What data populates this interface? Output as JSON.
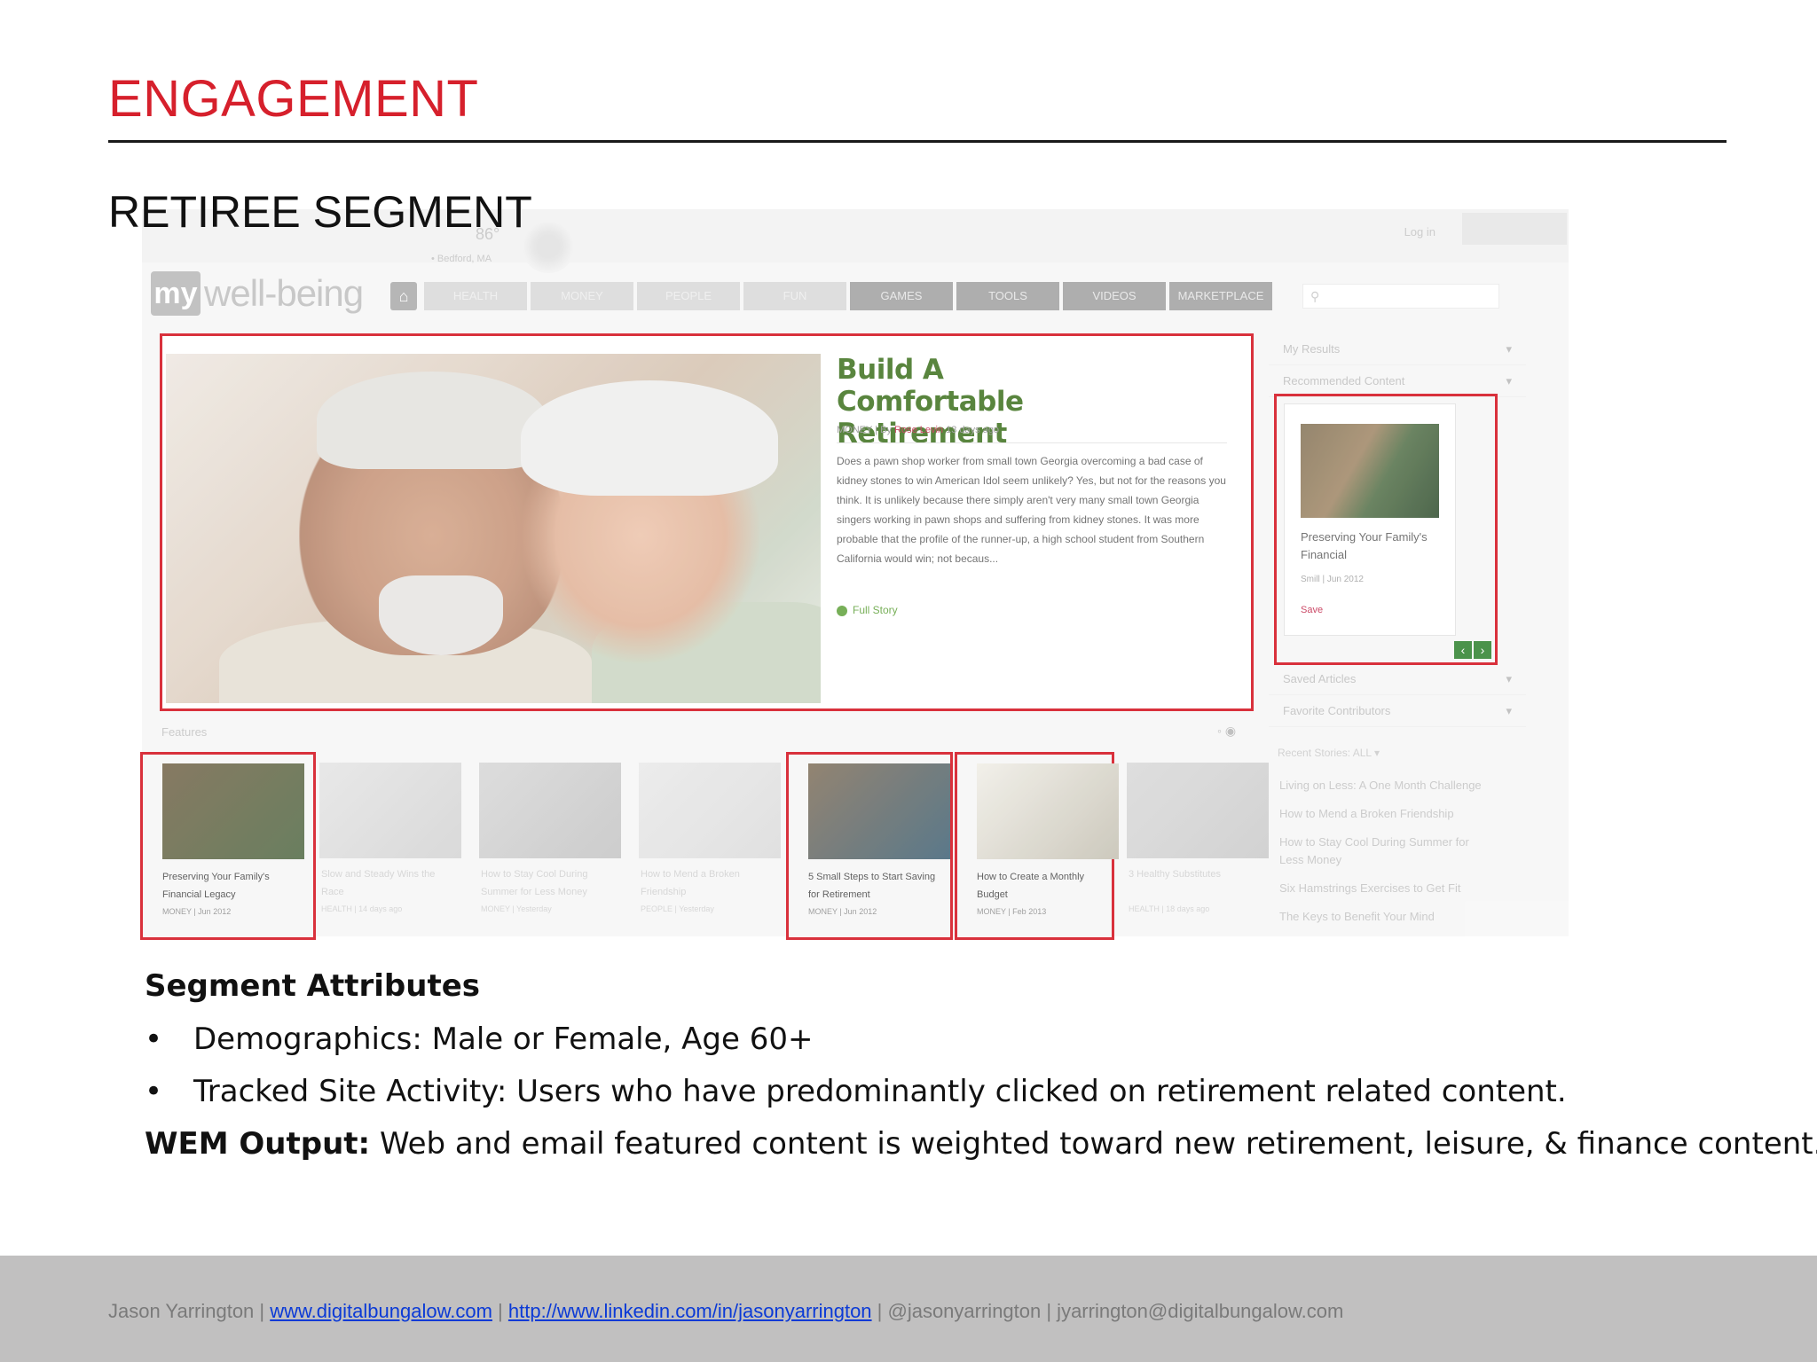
{
  "slide": {
    "title": "ENGAGEMENT",
    "subtitle": "RETIREE SEGMENT"
  },
  "site": {
    "login": "Log in",
    "weather_temp": "86°",
    "weather_location": "• Bedford, MA",
    "logo_my": "my",
    "logo_name": "well-being",
    "nav": [
      "HEALTH",
      "MONEY",
      "PEOPLE",
      "FUN",
      "GAMES",
      "TOOLS",
      "VIDEOS",
      "MARKETPLACE"
    ],
    "hero": {
      "title": "Build A Comfortable Retirement",
      "meta_section": "MONEY | By ",
      "meta_author": "Rose Levin",
      "meta_time": " 13 days ago",
      "body": "Does a pawn shop worker from small town Georgia overcoming a bad case of kidney stones to win American Idol seem unlikely? Yes, but not for the reasons you think. It is unlikely because there simply aren't very many small town Georgia singers working in pawn shops and suffering from kidney stones. It was more probable that the profile of the runner-up, a high school student from Southern California would win; not becaus...",
      "full_story": "Full Story"
    },
    "sidebar": {
      "my_results": "My Results",
      "recommended": "Recommended Content",
      "rec_title": "Preserving Your Family's Financial",
      "rec_meta": "Smill | Jun 2012",
      "rec_save": "Save",
      "saved_articles": "Saved Articles",
      "favorite_contributors": "Favorite Contributors",
      "recent_stories": "Recent Stories: ALL ▾",
      "recent": [
        "Living on Less: A One Month Challenge",
        "How to Mend a Broken Friendship",
        "How to Stay Cool During Summer for Less Money",
        "Six Hamstrings Exercises to Get Fit",
        "The Keys to Benefit Your Mind"
      ]
    },
    "features_label": "Features",
    "tiles": [
      {
        "title": "Preserving Your Family's Financial Legacy",
        "meta": "MONEY | Jun 2012",
        "color1": "#7d6e55",
        "color2": "#5d7552"
      },
      {
        "title": "Slow and Steady Wins the Race",
        "meta": "HEALTH | 14 days ago",
        "color1": "#e6e6e6",
        "color2": "#d7d7d7"
      },
      {
        "title": "How to Stay Cool During Summer for Less Money",
        "meta": "MONEY | Yesterday",
        "color1": "#dadada",
        "color2": "#c9c9c9"
      },
      {
        "title": "How to Mend a Broken Friendship",
        "meta": "PEOPLE | Yesterday",
        "color1": "#ebebeb",
        "color2": "#dedede"
      },
      {
        "title": "5 Small Steps to Start Saving for Retirement",
        "meta": "MONEY | Jun 2012",
        "color1": "#8a7a66",
        "color2": "#4d6d80"
      },
      {
        "title": "How to Create a Monthly Budget",
        "meta": "MONEY | Feb 2013",
        "color1": "#f1efe8",
        "color2": "#c9c5b8"
      },
      {
        "title": "3 Healthy Substitutes",
        "meta": "HEALTH | 18 days ago",
        "color1": "#dcdcdc",
        "color2": "#cfcfcf"
      }
    ]
  },
  "caption": {
    "attr_heading": "Segment Attributes",
    "bullets": [
      "Demographics: Male or Female, Age 60+",
      "Tracked Site Activity: Users who have predominantly clicked on retirement related content."
    ],
    "bullet_char": "•",
    "wem_label": "WEM Output:",
    "wem_text": " Web and email featured content is weighted toward new retirement, leisure, & finance content."
  },
  "footer": {
    "name": "Jason Yarrington | ",
    "site_link": "www.digitalbungalow.com",
    "sep1": " | ",
    "linkedin_link": "http://www.linkedin.com/in/jasonyarrington",
    "rest": " | @jasonyarrington | jyarrington@digitalbungalow.com"
  },
  "colors": {
    "accent_red": "#d6202c",
    "site_green": "#4c7b2e",
    "footer_bg": "#c1c0c0",
    "link_blue": "#0b3ad6"
  }
}
